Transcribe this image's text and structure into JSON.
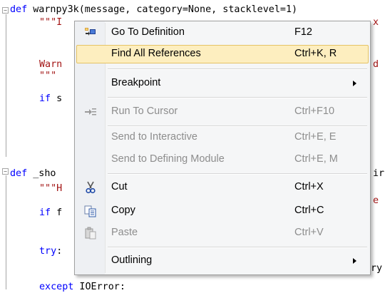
{
  "code": {
    "lines": [
      {
        "kw": "def",
        "rest": " warnpy3k(message, category=None, stacklevel=1)"
      },
      {
        "str": "\"\"\"I",
        "tail_str": "x"
      },
      {
        "text": "Warn",
        "tail": "d"
      },
      {
        "str": "\"\"\""
      },
      {
        "kw": "if",
        "rest": " s"
      },
      {
        "kw": "def",
        "rest": " _sho",
        "tail": "ir"
      },
      {
        "str": "\"\"\"H",
        "tail_str": "e"
      },
      {
        "kw": "if",
        "rest": " f"
      },
      {
        "kw": "try",
        "rest": ":"
      },
      {
        "tail": "ry"
      },
      {
        "kw": "except",
        "rest": " IOError:"
      }
    ]
  },
  "context_menu": {
    "items": [
      {
        "label": "Go To Definition",
        "shortcut": "F12",
        "icon": "go-to-definition-icon",
        "enabled": true
      },
      {
        "label": "Find All References",
        "shortcut": "Ctrl+K, R",
        "enabled": true,
        "highlighted": true
      },
      {
        "label": "Breakpoint",
        "shortcut": "",
        "enabled": true,
        "submenu": true
      },
      {
        "label": "Run To Cursor",
        "shortcut": "Ctrl+F10",
        "icon": "run-to-cursor-icon",
        "enabled": false
      },
      {
        "label": "Send to Interactive",
        "shortcut": "Ctrl+E, E",
        "enabled": false
      },
      {
        "label": "Send to Defining Module",
        "shortcut": "Ctrl+E, M",
        "enabled": false
      },
      {
        "label": "Cut",
        "shortcut": "Ctrl+X",
        "icon": "scissors-icon",
        "enabled": true
      },
      {
        "label": "Copy",
        "shortcut": "Ctrl+C",
        "icon": "copy-icon",
        "enabled": true
      },
      {
        "label": "Paste",
        "shortcut": "Ctrl+V",
        "icon": "paste-icon",
        "enabled": false
      },
      {
        "label": "Outlining",
        "shortcut": "",
        "enabled": true,
        "submenu": true
      }
    ],
    "colors": {
      "highlight_fill": "#fdeebf",
      "highlight_border": "#e5c365",
      "disabled_text": "#8d8d8d"
    }
  }
}
